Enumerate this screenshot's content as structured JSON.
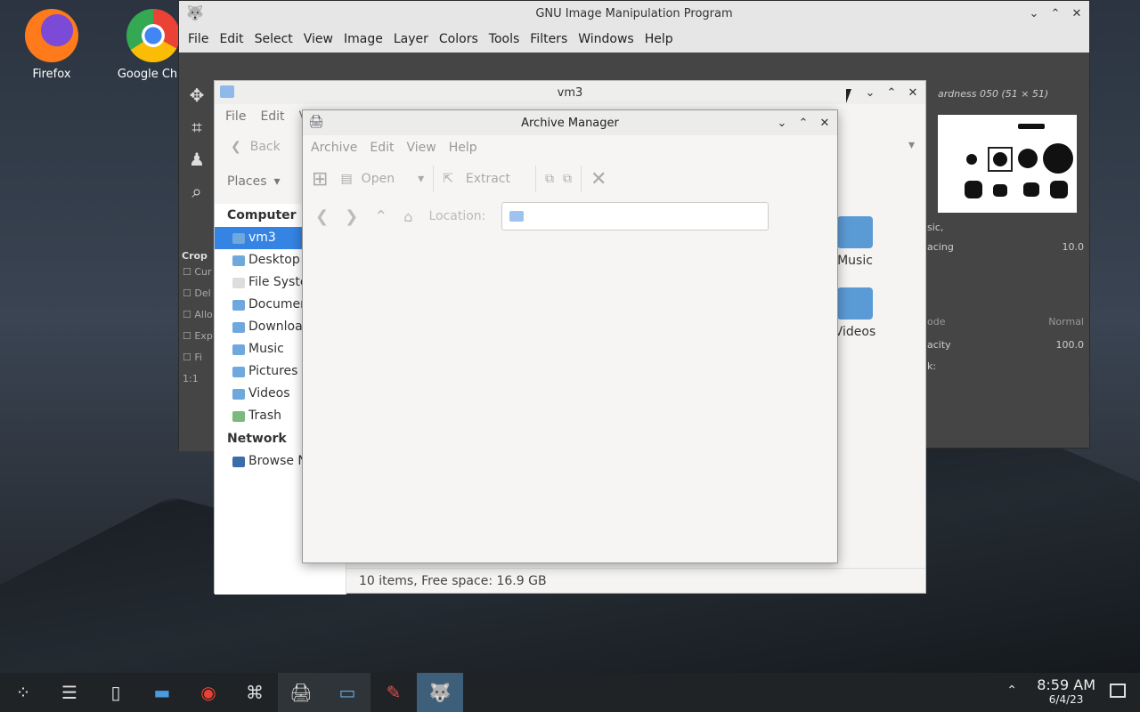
{
  "desktop": {
    "icons": [
      {
        "label": "Firefox",
        "icon": "firefox-icon"
      },
      {
        "label": "Google Chro",
        "icon": "chrome-icon"
      }
    ]
  },
  "gimp": {
    "title": "GNU Image Manipulation Program",
    "menu": [
      "File",
      "Edit",
      "Select",
      "View",
      "Image",
      "Layer",
      "Colors",
      "Tools",
      "Filters",
      "Windows",
      "Help"
    ],
    "tool_options": {
      "title": "Crop",
      "options": [
        "Cur",
        "Del",
        "Allo",
        "Exp",
        "Fi"
      ],
      "ratio": "1:1"
    },
    "brush": {
      "name": "ardness 050 (51 × 51)",
      "preset": "sic,",
      "spacing_label": "acing",
      "spacing": "10.0"
    },
    "layers": {
      "mode_label": "ode",
      "mode": "Normal",
      "opacity_label": "acity",
      "opacity": "100.0",
      "lock_label": "k:"
    }
  },
  "files": {
    "title": "vm3",
    "menu": [
      "File",
      "Edit",
      "V"
    ],
    "nav": {
      "back": "Back",
      "places": "Places"
    },
    "sidebar": {
      "computer_heading": "Computer",
      "items": [
        {
          "label": "vm3",
          "selected": true
        },
        {
          "label": "Desktop"
        },
        {
          "label": "File Syste"
        },
        {
          "label": "Documen"
        },
        {
          "label": "Downloa"
        },
        {
          "label": "Music"
        },
        {
          "label": "Pictures"
        },
        {
          "label": "Videos"
        },
        {
          "label": "Trash"
        }
      ],
      "network_heading": "Network",
      "network_items": [
        {
          "label": "Browse N"
        }
      ]
    },
    "folders": [
      {
        "label": "Music"
      },
      {
        "label": "Videos"
      }
    ],
    "status": "10 items, Free space: 16.9 GB"
  },
  "archive": {
    "title": "Archive Manager",
    "menu": [
      "Archive",
      "Edit",
      "View",
      "Help"
    ],
    "toolbar": {
      "open": "Open",
      "extract": "Extract"
    },
    "location_label": "Location:",
    "location_value": ""
  },
  "taskbar": {
    "time": "8:59 AM",
    "date": "6/4/23"
  }
}
